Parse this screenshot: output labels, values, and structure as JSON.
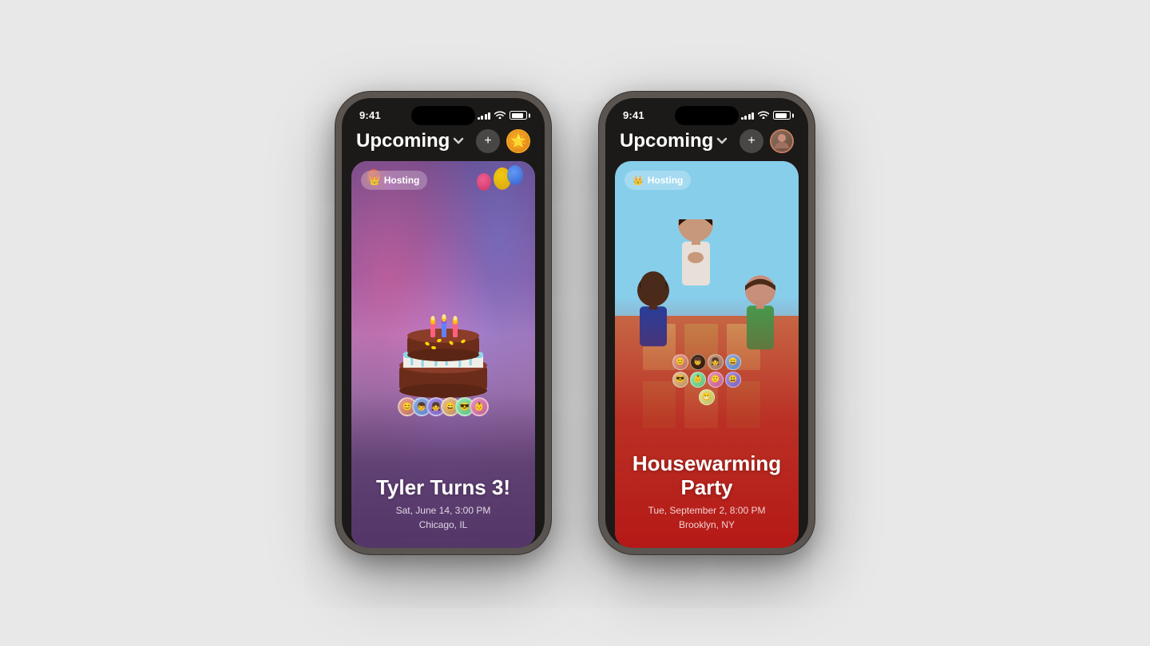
{
  "page": {
    "background": "#e8e8e8"
  },
  "phone1": {
    "status_time": "9:41",
    "nav_title": "Upcoming",
    "nav_chevron": "›",
    "nav_add": "+",
    "hosting_label": "Hosting",
    "event_title": "Tyler Turns 3!",
    "event_date": "Sat, June 14, 3:00 PM",
    "event_location": "Chicago, IL",
    "attendees_count": 6
  },
  "phone2": {
    "status_time": "9:41",
    "nav_title": "Upcoming",
    "nav_chevron": "›",
    "nav_add": "+",
    "hosting_label": "Hosting",
    "event_title": "Housewarming Party",
    "event_date": "Tue, September 2, 8:00 PM",
    "event_location": "Brooklyn, NY",
    "attendees_count": 9
  },
  "icons": {
    "crown": "👑",
    "plus": "+",
    "chevron_down": "∨"
  }
}
